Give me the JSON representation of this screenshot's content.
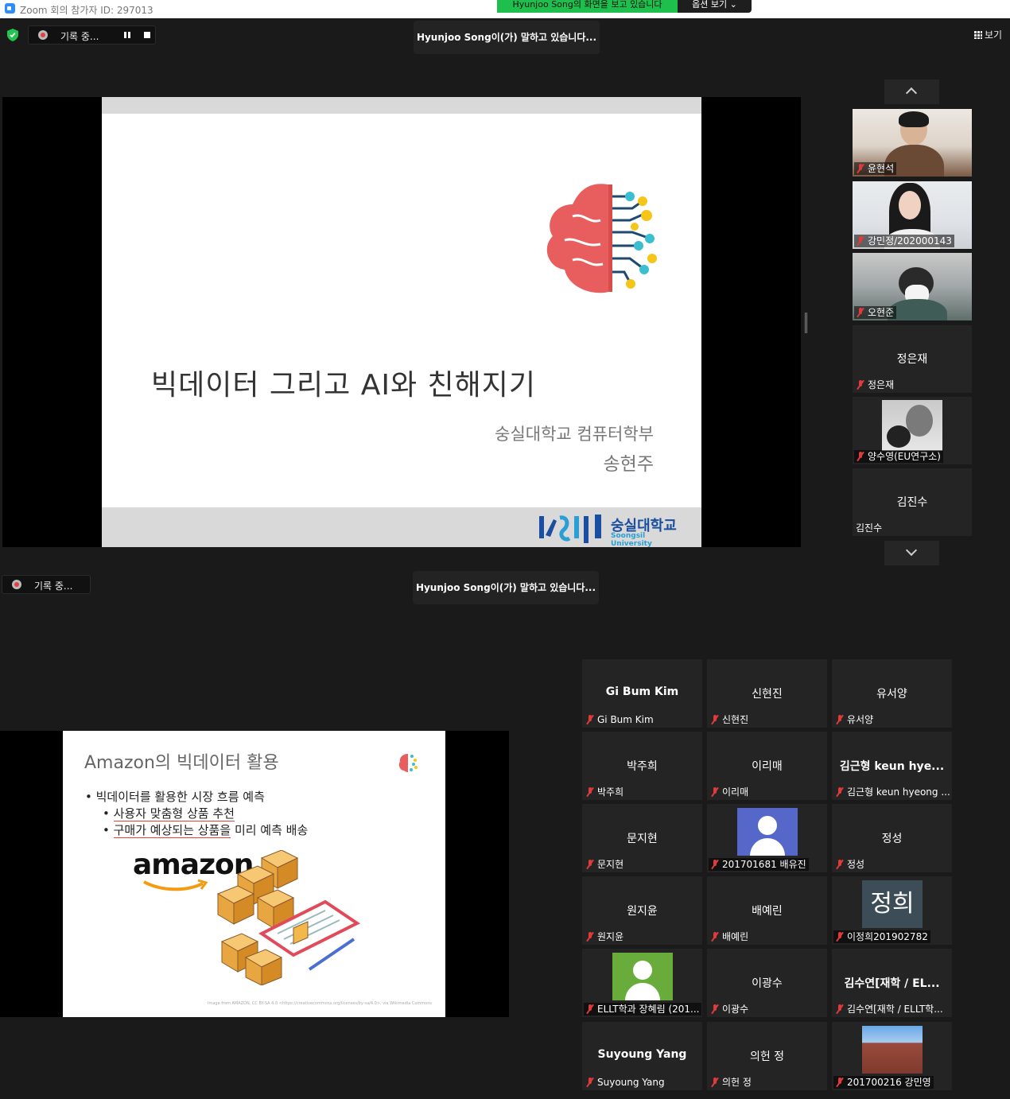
{
  "titlebar": {
    "title": "Zoom 회의 참가자 ID: 297013"
  },
  "share_banner": {
    "text": "Hyunjoo  Song의 화면을 보고 있습니다",
    "options_label": "옵션 보기 ⌄"
  },
  "recording": {
    "label": "기록 중..."
  },
  "speaking": {
    "text": "Hyunjoo  Song이(가) 말하고 있습니다..."
  },
  "view": {
    "label": "보기"
  },
  "slide1": {
    "title": "빅데이터 그리고 AI와 친해지기",
    "dept": "숭실대학교 컴퓨터학부",
    "name": "송현주",
    "logo_kr": "숭실대학교",
    "logo_en": "Soongsil University"
  },
  "side_tiles": [
    {
      "label": "윤현석"
    },
    {
      "label": "강민정/202000143"
    },
    {
      "label": "오현준"
    },
    {
      "center": "정은재",
      "label": "정은재"
    },
    {
      "label": "양수영(EU연구소)"
    },
    {
      "center": "김진수",
      "label": "김진수"
    }
  ],
  "slide2": {
    "title": "Amazon의 빅데이터 활용",
    "bullet1": "• 빅데이터를 활용한 시장 흐름 예측",
    "bullet2_prefix": "• ",
    "bullet2": "사용자 맞춤형 상품 추천",
    "bullet3_prefix": "• ",
    "bullet3": "구매가 예상되는 상품을",
    "bullet3_suffix": " 미리 예측 배송",
    "brand": "amazon",
    "credit": "Image from AMAZON, CC BY-SA 4.0 <https://creativecommons.org/licenses/by-sa/4.0>, via Wikimedia Commons"
  },
  "grid_tiles": [
    {
      "center": "Gi Bum Kim",
      "label": "Gi Bum Kim"
    },
    {
      "center": "신현진",
      "label": "신현진"
    },
    {
      "center": "유서양",
      "label": "유서양"
    },
    {
      "center": "박주희",
      "label": "박주희"
    },
    {
      "center": "이리매",
      "label": "이리매"
    },
    {
      "center": "김근형 keun hye...",
      "label": "김근형 keun hyeong ..."
    },
    {
      "center": "문지현",
      "label": "문지현"
    },
    {
      "label": "201701681 배유진"
    },
    {
      "center": "정성",
      "label": "정성"
    },
    {
      "center": "원지윤",
      "label": "원지윤"
    },
    {
      "center": "배예린",
      "label": "배예린"
    },
    {
      "avatar_text": "정희",
      "label": "이정희201902782"
    },
    {
      "label": "ELLT학과 장혜림 (201..."
    },
    {
      "center": "이광수",
      "label": "이광수"
    },
    {
      "center": "김수연[재학 / EL...",
      "label": "김수연[재학 / ELLT학..."
    },
    {
      "center": "Suyoung Yang",
      "label": "Suyoung Yang"
    },
    {
      "center": "의헌 정",
      "label": "의헌 정"
    },
    {
      "label": "201700216 강민영"
    }
  ],
  "colors": {
    "share_green": "#1fbf4d",
    "muted_red": "#e03a3a",
    "avatar_blue": "#5568c9",
    "avatar_green": "#6aac3b"
  }
}
